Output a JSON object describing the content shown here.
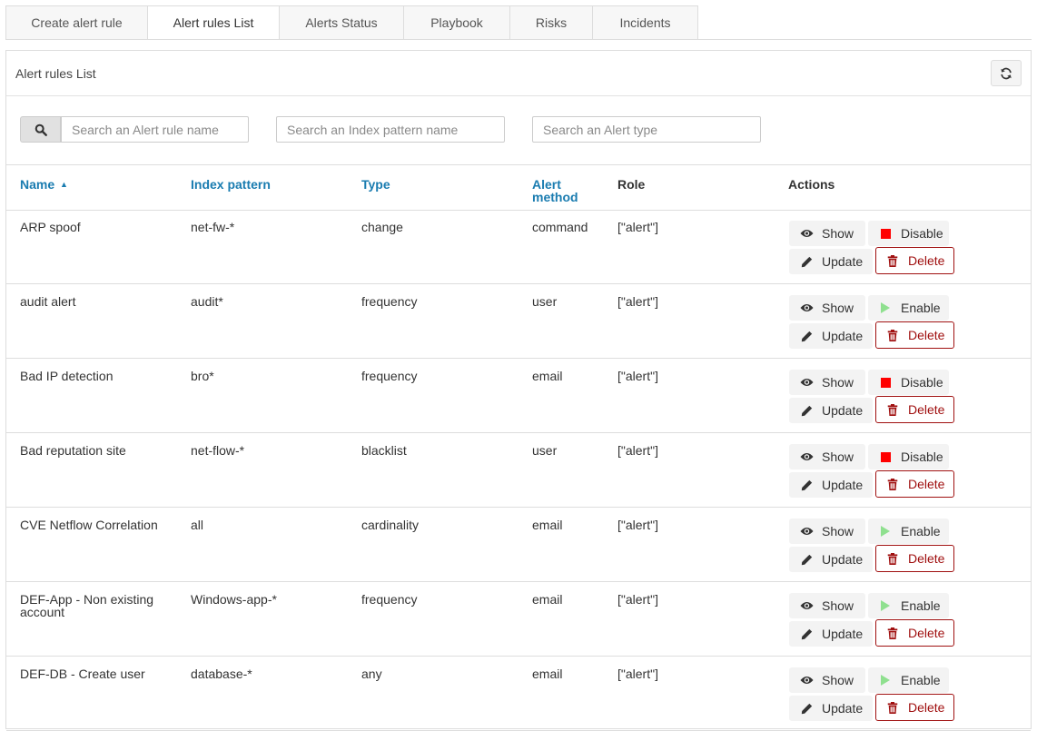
{
  "tabs": [
    {
      "label": "Create alert rule",
      "active": false
    },
    {
      "label": "Alert rules List",
      "active": true
    },
    {
      "label": "Alerts Status",
      "active": false
    },
    {
      "label": "Playbook",
      "active": false
    },
    {
      "label": "Risks",
      "active": false
    },
    {
      "label": "Incidents",
      "active": false
    }
  ],
  "panel": {
    "title": "Alert rules List"
  },
  "search": {
    "rule_placeholder": "Search an Alert rule name",
    "index_placeholder": "Search an Index pattern name",
    "type_placeholder": "Search an Alert type"
  },
  "columns": {
    "name": "Name",
    "sort_indicator": "▲",
    "index": "Index pattern",
    "type": "Type",
    "method_line1": "Alert",
    "method_line2": "method",
    "role": "Role",
    "actions": "Actions"
  },
  "labels": {
    "show": "Show",
    "update": "Update",
    "delete": "Delete",
    "enable": "Enable",
    "disable": "Disable"
  },
  "colors": {
    "link": "#1a7cb0",
    "disable_icon": "#ff0000",
    "enable_icon": "#8fe08f",
    "delete": "#a01010"
  },
  "rows": [
    {
      "name_line1": "ARP spoof",
      "name_line2": "",
      "index": "net-fw-*",
      "type": "change",
      "method": "command",
      "role": "[\"alert\"]",
      "toggle": "Disable"
    },
    {
      "name_line1": "audit alert",
      "name_line2": "",
      "index": "audit*",
      "type": "frequency",
      "method": "user",
      "role": "[\"alert\"]",
      "toggle": "Enable"
    },
    {
      "name_line1": "Bad IP detection",
      "name_line2": "",
      "index": "bro*",
      "type": "frequency",
      "method": "email",
      "role": "[\"alert\"]",
      "toggle": "Disable"
    },
    {
      "name_line1": "Bad reputation site",
      "name_line2": "",
      "index": "net-flow-*",
      "type": "blacklist",
      "method": "user",
      "role": "[\"alert\"]",
      "toggle": "Disable"
    },
    {
      "name_line1": "CVE Netflow Correlation",
      "name_line2": "",
      "index": "all",
      "type": "cardinality",
      "method": "email",
      "role": "[\"alert\"]",
      "toggle": "Enable"
    },
    {
      "name_line1": "DEF-App - Non existing",
      "name_line2": "account",
      "index": "Windows-app-*",
      "type": "frequency",
      "method": "email",
      "role": "[\"alert\"]",
      "toggle": "Enable"
    },
    {
      "name_line1": "DEF-DB - Create user",
      "name_line2": "",
      "index": "database-*",
      "type": "any",
      "method": "email",
      "role": "[\"alert\"]",
      "toggle": "Enable"
    }
  ]
}
